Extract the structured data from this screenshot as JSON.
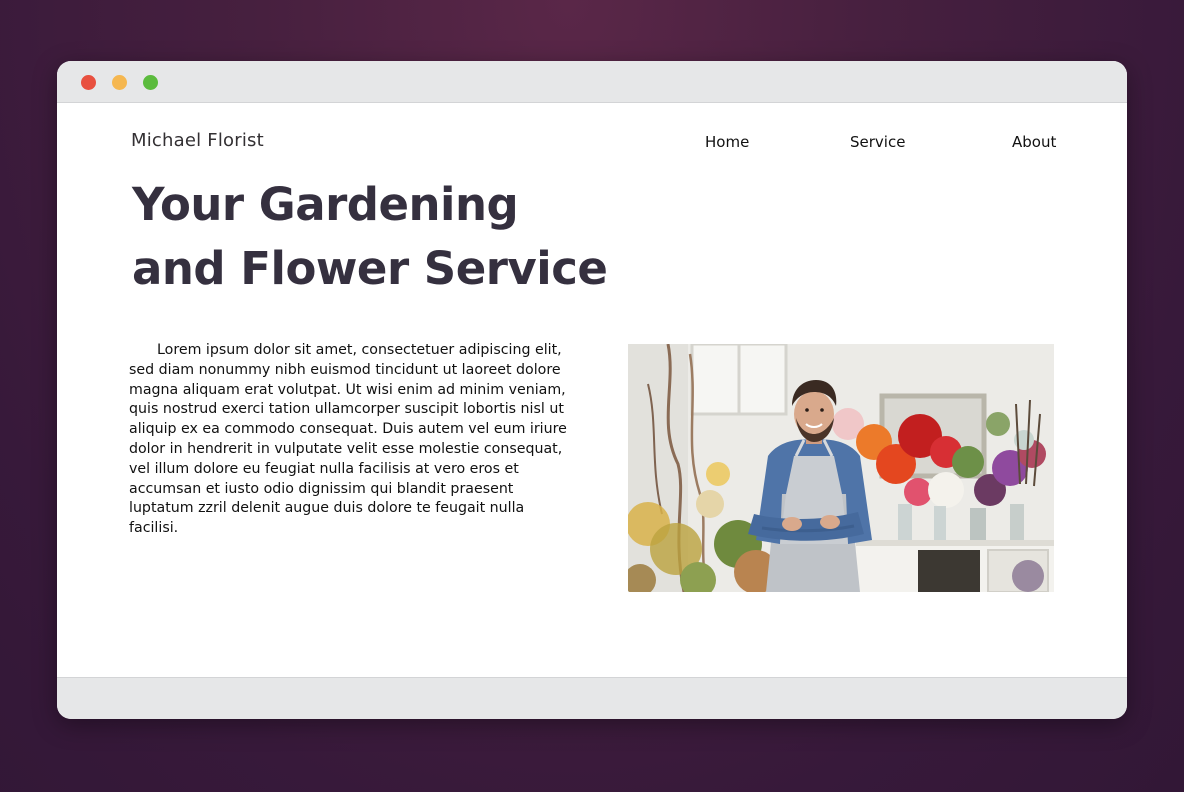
{
  "window": {
    "traffic_lights": [
      "close",
      "minimize",
      "zoom"
    ],
    "colors": {
      "close": "#e8503f",
      "minimize": "#f5b750",
      "zoom": "#5bbb3d",
      "heading": "#35303f"
    }
  },
  "header": {
    "brand": "Michael Florist",
    "nav": [
      {
        "label": "Home"
      },
      {
        "label": "Service"
      },
      {
        "label": "About"
      }
    ]
  },
  "hero": {
    "title_line1": "Your Gardening",
    "title_line2": "and Flower Service"
  },
  "main": {
    "body": "Lorem ipsum dolor sit amet, consectetuer adipiscing elit, sed diam nonummy nibh euismod tincidunt ut laoreet dolore magna aliquam erat volutpat. Ut wisi enim ad minim veniam, quis nostrud exerci tation ullamcorper suscipit lobortis nisl ut aliquip ex ea commodo consequat. Duis autem vel eum iriure dolor in hendrerit in vulputate velit esse molestie consequat, vel illum dolore eu feugiat nulla facilisis at vero eros et accumsan et iusto odio dignissim qui blandit praesent luptatum zzril delenit augue duis dolore te feugait nulla facilisi."
  }
}
